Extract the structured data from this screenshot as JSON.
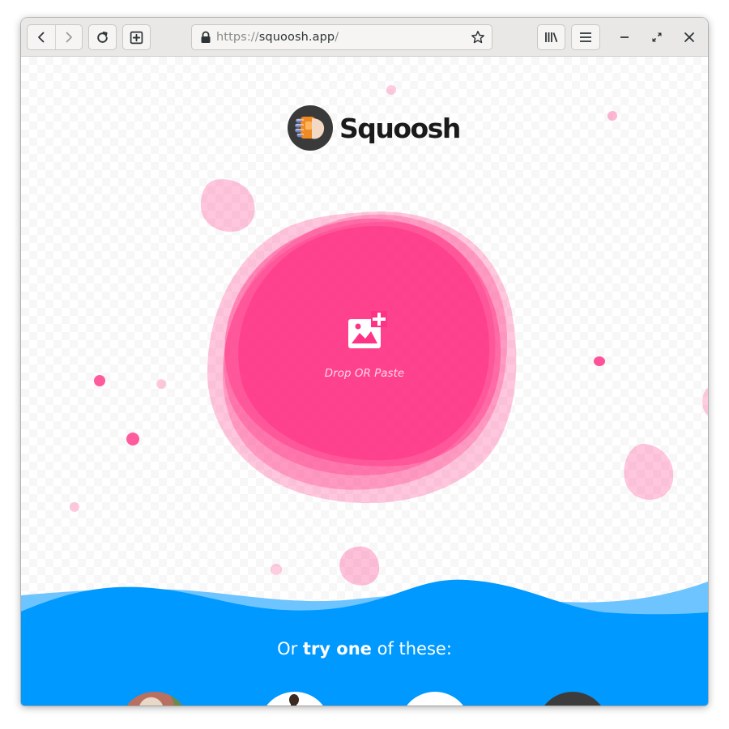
{
  "browser": {
    "url_scheme": "https://",
    "url_host": "squoosh.app",
    "url_path": "/",
    "icons": {
      "back": "chevron-left-icon",
      "forward": "chevron-right-icon",
      "reload": "reload-icon",
      "new_tab": "new-tab-icon",
      "lock": "lock-icon",
      "bookmark": "star-icon",
      "library": "library-icon",
      "menu": "hamburger-menu-icon",
      "minimize": "minimize-icon",
      "maximize": "maximize-icon",
      "close": "close-icon"
    }
  },
  "app": {
    "logo_text": "Squoosh",
    "drop_label": "Drop OR Paste",
    "try_prefix": "Or ",
    "try_strong": "try one",
    "try_suffix": " of these:",
    "demo_count": 4
  },
  "colors": {
    "pink_accent": "#ff3385",
    "pink_light": "#ffb3d1",
    "blue": "#0099ff",
    "blue_light": "#6dc4ff"
  }
}
